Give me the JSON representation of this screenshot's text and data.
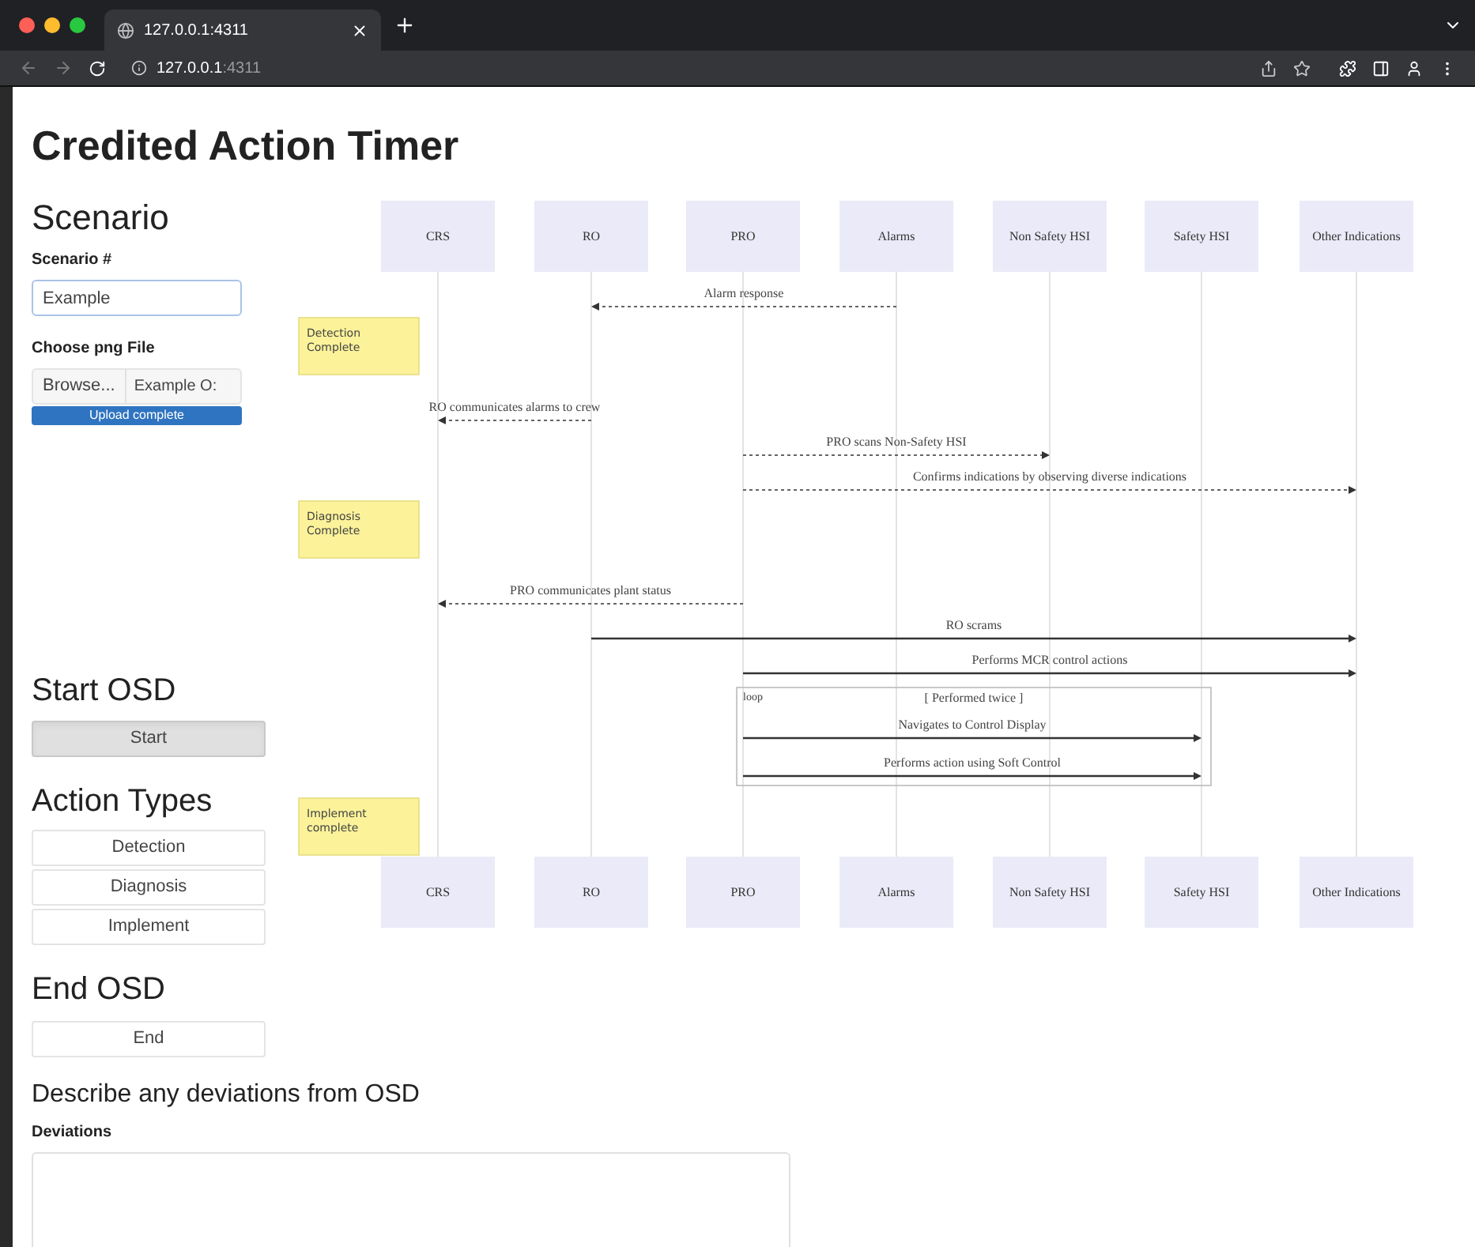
{
  "browser": {
    "tab_title": "127.0.0.1:4311",
    "url_host": "127.0.0.1",
    "url_port": ":4311"
  },
  "title": "Credited Action Timer",
  "scenario": {
    "heading": "Scenario",
    "field_label": "Scenario #",
    "field_value": "Example",
    "file_label": "Choose png File",
    "browse": "Browse...",
    "file_name": "Example O:",
    "progress": {
      "text": "Upload complete",
      "level": 1
    }
  },
  "start": {
    "heading": "Start OSD",
    "button": "Start",
    "pressed": true
  },
  "action_types": {
    "heading": "Action Types",
    "buttons": [
      {
        "label": "Detection",
        "pressed": false
      },
      {
        "label": "Diagnosis",
        "pressed": false
      },
      {
        "label": "Implement",
        "pressed": false
      }
    ]
  },
  "end": {
    "heading": "End OSD",
    "button": "End",
    "pressed": false
  },
  "deviations": {
    "heading": "Describe any deviations from OSD",
    "label": "Deviations"
  },
  "diagram": {
    "participants": [
      "CRS",
      "RO",
      "PRO",
      "Alarms",
      "Non Safety HSI",
      "Safety HSI",
      "Other Indications"
    ],
    "participants_bottom": [
      "CRS",
      "RO",
      "PRO",
      "Alarms",
      "Non Safety HSI",
      "Safety HSI",
      "Other Indications"
    ],
    "events": [
      {
        "kind": "reply",
        "label": "Alarm response"
      },
      {
        "kind": "note",
        "text": "Detection Complete"
      },
      {
        "kind": "reply",
        "label": "RO communicates alarms to crew"
      },
      {
        "kind": "reply",
        "label": "PRO scans Non-Safety HSI"
      },
      {
        "kind": "reply",
        "label": "Confirms indications by observing diverse indications"
      },
      {
        "kind": "note",
        "text": "Diagnosis Complete"
      },
      {
        "kind": "reply",
        "label": "PRO communicates plant status"
      },
      {
        "kind": "call",
        "label": "RO scrams"
      },
      {
        "kind": "call",
        "label": "Performs MCR control actions"
      },
      {
        "kind": "loop",
        "label": "loop",
        "condition": "[ Performed twice ]",
        "messages": [
          {
            "kind": "call",
            "label": "Navigates to Control Display"
          },
          {
            "kind": "call",
            "label": "Performs action using Soft Control"
          }
        ]
      },
      {
        "kind": "note",
        "text": "Implement complete"
      }
    ]
  }
}
